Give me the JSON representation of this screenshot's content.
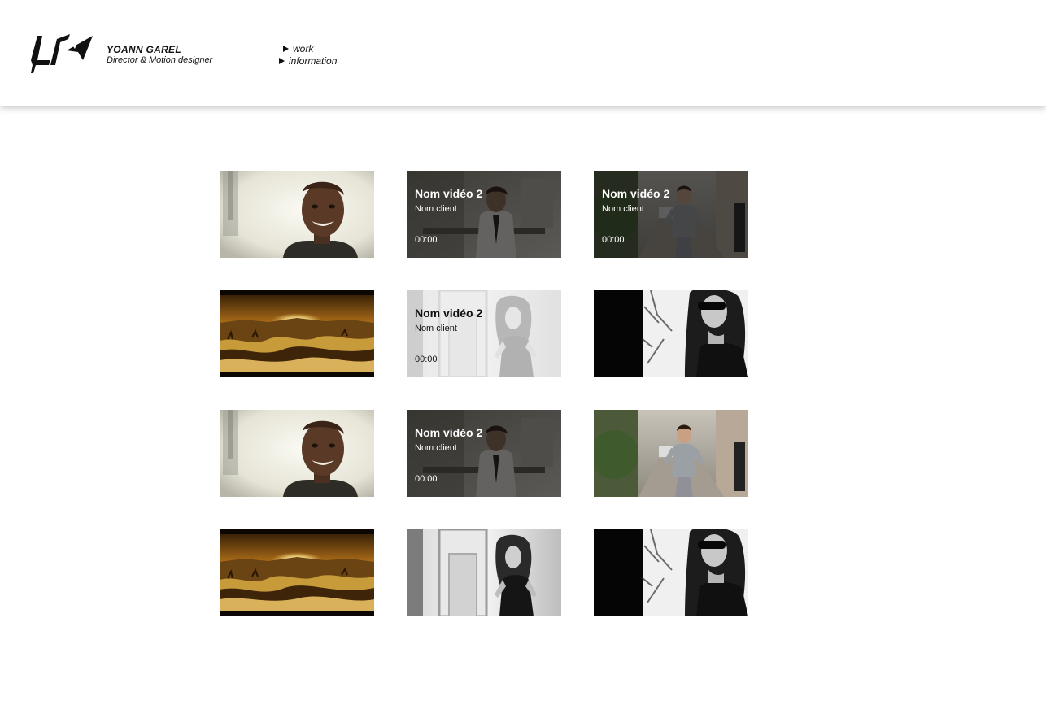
{
  "header": {
    "name": "YOANN GAREL",
    "subtitle": "Director & Motion designer",
    "nav": [
      {
        "label": "work"
      },
      {
        "label": "information"
      }
    ]
  },
  "grid": {
    "overlay": {
      "title": "Nom vidéo 2",
      "client": "Nom client",
      "duration": "00:00"
    },
    "items": [
      {
        "image": "smiling-man-portrait",
        "overlay": false
      },
      {
        "image": "man-in-office",
        "overlay": true,
        "theme": "dark"
      },
      {
        "image": "man-walking-street",
        "overlay": true,
        "theme": "dark"
      },
      {
        "image": "desert-sunset",
        "overlay": false
      },
      {
        "image": "woman-at-mirror",
        "overlay": true,
        "theme": "light"
      },
      {
        "image": "woman-sunglasses",
        "overlay": false
      },
      {
        "image": "smiling-man-portrait",
        "overlay": false
      },
      {
        "image": "man-in-office",
        "overlay": true,
        "theme": "dark"
      },
      {
        "image": "man-walking-street",
        "overlay": false
      },
      {
        "image": "desert-sunset",
        "overlay": false
      },
      {
        "image": "woman-at-mirror",
        "overlay": false
      },
      {
        "image": "woman-sunglasses",
        "overlay": false
      }
    ]
  }
}
